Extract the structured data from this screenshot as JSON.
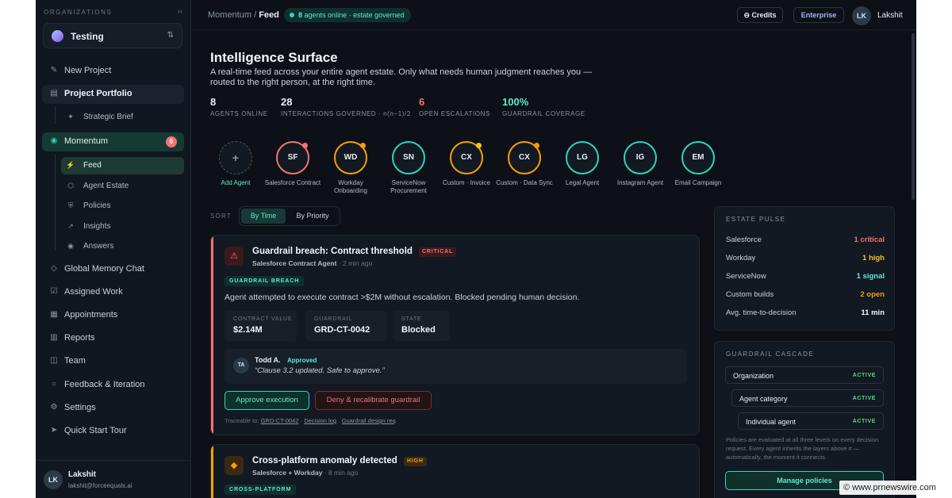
{
  "sidebar": {
    "org_label": "ORGANIZATIONS",
    "collapse_glyph": "‹‹",
    "org_name": "Testing",
    "items": [
      {
        "label": "New Project"
      },
      {
        "label": "Project Portfolio"
      },
      {
        "label": "Strategic Brief"
      },
      {
        "label": "Momentum",
        "badge": "6"
      },
      {
        "label": "Feed"
      },
      {
        "label": "Agent Estate"
      },
      {
        "label": "Policies"
      },
      {
        "label": "Insights"
      },
      {
        "label": "Answers"
      },
      {
        "label": "Global Memory Chat"
      },
      {
        "label": "Assigned Work"
      },
      {
        "label": "Appointments"
      },
      {
        "label": "Reports"
      },
      {
        "label": "Team"
      },
      {
        "label": "Feedback & Iteration"
      },
      {
        "label": "Settings"
      },
      {
        "label": "Quick Start Tour"
      }
    ],
    "user": {
      "initials": "LK",
      "name": "Lakshit",
      "email": "lakshit@forceequals.ai"
    }
  },
  "topbar": {
    "crumb_parent": "Momentum /",
    "crumb_current": "Feed",
    "online_count": "8",
    "online_text": "agents online · estate governed",
    "credits_label": "⊖ Credits",
    "plan_label": "Enterprise",
    "user_initials": "LK",
    "user_name": "Lakshit"
  },
  "main": {
    "title": "Intelligence Surface",
    "description": "A real-time feed across your entire agent estate. Only what needs human judgment reaches you — routed to the right person, at the right time.",
    "stats": [
      {
        "value": "8",
        "caption": "AGENTS ONLINE",
        "color": "#f0f6fc"
      },
      {
        "value": "28",
        "caption": "INTERACTIONS GOVERNED · n(n−1)/2",
        "color": "#f0f6fc"
      },
      {
        "value": "6",
        "caption": "OPEN ESCALATIONS",
        "color": "#f87171"
      },
      {
        "value": "100%",
        "caption": "GUARDRAIL COVERAGE",
        "color": "#5eead4"
      }
    ],
    "agents": [
      {
        "initials": "+",
        "name": "Add Agent"
      },
      {
        "initials": "SF",
        "name": "Salesforce Contract",
        "ring": "#f87171",
        "notif": "#f87171"
      },
      {
        "initials": "WD",
        "name": "Workday Onboarding",
        "ring": "#f59e0b",
        "notif": "#f59e0b"
      },
      {
        "initials": "SN",
        "name": "ServiceNow Procurement",
        "ring": "#2dd4bf"
      },
      {
        "initials": "CX",
        "name": "Custom · Invoice",
        "ring": "#f59e0b",
        "notif": "#fbbf24"
      },
      {
        "initials": "CX",
        "name": "Custom · Data Sync",
        "ring": "#f59e0b",
        "notif": "#f59e0b"
      },
      {
        "initials": "LG",
        "name": "Legal Agent",
        "ring": "#2dd4bf"
      },
      {
        "initials": "IG",
        "name": "Instagram Agent",
        "ring": "#2dd4bf"
      },
      {
        "initials": "EM",
        "name": "Email Campaign",
        "ring": "#2dd4bf"
      }
    ],
    "sort": {
      "label": "SORT",
      "by_time": "By Time",
      "by_priority": "By Priority"
    }
  },
  "cards": [
    {
      "title": "Guardrail breach: Contract threshold",
      "severity": "CRITICAL",
      "source": "Salesforce Contract Agent",
      "time": "· 2 min ago",
      "tag": "GUARDRAIL BREACH",
      "body": "Agent attempted to execute contract >$2M without escalation. Blocked pending human decision.",
      "fields": [
        {
          "k": "CONTRACT VALUE",
          "v": "$2.14M"
        },
        {
          "k": "GUARDRAIL",
          "v": "GRD-CT-0042"
        },
        {
          "k": "STATE",
          "v": "Blocked"
        }
      ],
      "comment": {
        "initials": "TA",
        "who": "Todd A.",
        "status": "Approved",
        "text": "“Clause 3.2 updated. Safe to approve.”"
      },
      "approve_label": "Approve execution",
      "deny_label": "Deny & recalibrate guardrail",
      "trace_prefix": "Traceable to:",
      "trace_1": "GRD-CT-0042",
      "trace_2": "Decision log",
      "trace_3": "Guardrail design req"
    },
    {
      "title": "Cross-platform anomaly detected",
      "severity": "HIGH",
      "source": "Salesforce + Workday",
      "time": "· 8 min ago",
      "tag": "CROSS-PLATFORM"
    }
  ],
  "pulse": {
    "heading": "ESTATE PULSE",
    "rows": [
      {
        "name": "Salesforce",
        "value": "1 critical",
        "color": "#f87171"
      },
      {
        "name": "Workday",
        "value": "1 high",
        "color": "#fbbf24"
      },
      {
        "name": "ServiceNow",
        "value": "1 signal",
        "color": "#5eead4"
      },
      {
        "name": "Custom builds",
        "value": "2 open",
        "color": "#f59e0b"
      },
      {
        "name": "Avg. time-to-decision",
        "value": "11 min",
        "color": "#f0f6fc"
      }
    ]
  },
  "cascade": {
    "heading": "GUARDRAIL CASCADE",
    "levels": [
      {
        "name": "Organization",
        "status": "ACTIVE"
      },
      {
        "name": "Agent category",
        "status": "ACTIVE"
      },
      {
        "name": "Individual agent",
        "status": "ACTIVE"
      }
    ],
    "note": "Policies are evaluated at all three levels on every decision request. Every agent inherits the layers above it — automatically, the moment it connects.",
    "manage_label": "Manage policies"
  },
  "watermark": "© www.prnewswire.com"
}
